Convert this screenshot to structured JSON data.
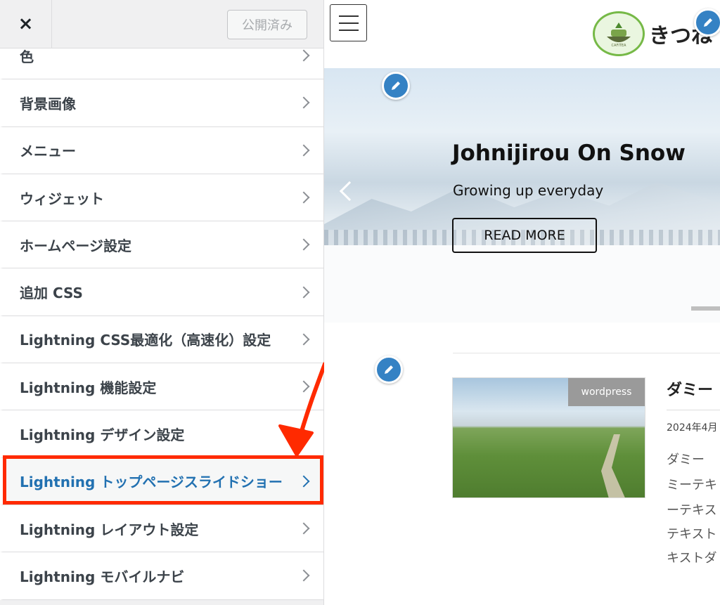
{
  "sidebar": {
    "close_icon": "×",
    "publish_label": "公開済み",
    "items": [
      {
        "label": "色"
      },
      {
        "label": "背景画像"
      },
      {
        "label": "メニュー"
      },
      {
        "label": "ウィジェット"
      },
      {
        "label": "ホームページ設定"
      },
      {
        "label": "追加 CSS"
      },
      {
        "label": "Lightning CSS最適化（高速化）設定"
      },
      {
        "label": "Lightning 機能設定"
      },
      {
        "label": "Lightning デザイン設定"
      },
      {
        "label": "Lightning トップページスライドショー"
      },
      {
        "label": "Lightning レイアウト設定"
      },
      {
        "label": "Lightning モバイルナビ"
      }
    ],
    "active_index": 9,
    "highlight_color": "#ff2a00",
    "active_color": "#2271b1"
  },
  "preview": {
    "logo_text": "きつね",
    "logo_badge": "CAFITEA",
    "slide": {
      "title": "Johnijirou On Snow",
      "subtitle": "Growing up everyday",
      "button_label": "READ MORE"
    },
    "post": {
      "category": "wordpress",
      "title": "ダミー",
      "date": "2024年4月",
      "excerpt": [
        "ダミー",
        "ミーテキ",
        "ーテキス",
        "テキスト",
        "キストダ"
      ]
    },
    "accent_color": "#3582c4"
  }
}
